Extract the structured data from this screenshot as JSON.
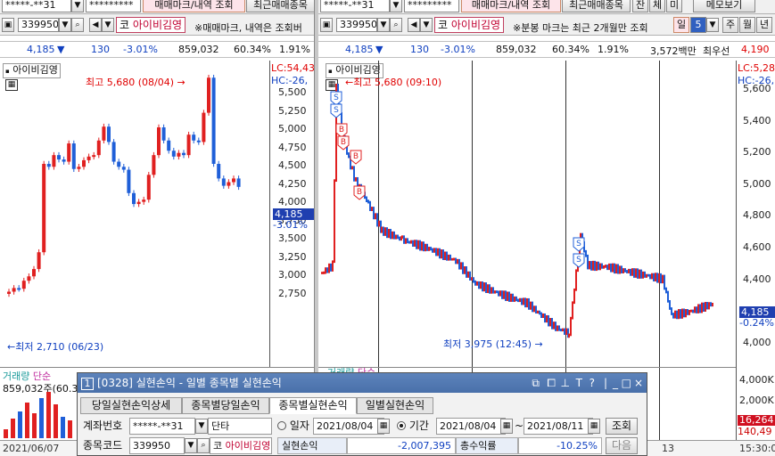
{
  "colors": {
    "up": "#e02020",
    "down": "#1f5fd8",
    "accent_pink": "#c00030",
    "title_bar": "#4970aa"
  },
  "left": {
    "account": "*****-**31",
    "password_mask": "*********",
    "trade_mark_button": "매매마크/내역 조회",
    "recent_trades_button": "최근매매종목",
    "code": "339950",
    "name_prefix": "코",
    "name": "아이비김영",
    "notice": "※매매마크, 내역은 조회버",
    "quote": {
      "price": "4,185",
      "arrow": "▼",
      "change": "130",
      "rate": "-3.01%",
      "volume": "859,032",
      "ratio": "60.34%",
      "turnover": "1.91%"
    },
    "chart_label": "아이비김영",
    "lc": "LC:54,43",
    "hc": "HC:-26,",
    "high_annotation": "최고 5,680 (08/04)",
    "low_annotation": "최저 2,710 (06/23)",
    "price_tag": "4,185",
    "price_tag_rate": "-3.01%",
    "volume_label": "거래량",
    "volume_label2": "단순",
    "volume_value": "859,032주(60.34",
    "date_label": "2021/06/07",
    "yticks": [
      "5,500",
      "5,250",
      "5,000",
      "4,750",
      "4,500",
      "4,250",
      "4,000",
      "3,750",
      "3,500",
      "3,250",
      "3,000",
      "2,750"
    ]
  },
  "right": {
    "account": "*****-**31",
    "password_mask": "*********",
    "trade_mark_button": "매매마크/내역 조회",
    "recent_trades_button": "최근매매종목",
    "btn_cham": "잔",
    "btn_je": "체",
    "btn_mi": "미",
    "memo_button": "메모보기",
    "code": "339950",
    "name_prefix": "코",
    "name": "아이비김영",
    "notice": "※분봉 마크는 최근 2개월만 조회",
    "period_il": "일",
    "period_num": "5",
    "period_ju": "주",
    "period_wol": "월",
    "period_nyeon": "년",
    "quote": {
      "price": "4,185",
      "arrow": "▼",
      "change": "130",
      "rate": "-3.01%",
      "volume": "859,032",
      "ratio": "60.34%",
      "turnover": "1.91%",
      "mktcap": "3,572백만",
      "best": "최우선",
      "best_price": "4,190"
    },
    "chart_label": "아이비김영",
    "lc": "LC:5,28",
    "hc": "HC:-26,",
    "high_annotation": "최고 5,680 (09:10)",
    "low_annotation": "최저 3,975 (12:45)",
    "price_tag": "4,185",
    "price_tag_rate": "-0.24%",
    "vol_axis_1": "4,000K",
    "vol_axis_2": "2,000K",
    "vol_tag_1": "16,264",
    "vol_tag_2": "140,49",
    "time_label": "15:30:0",
    "date_13": "13",
    "volume_label": "거래량",
    "volume_label2": "단순",
    "yticks": [
      "5,600",
      "5,400",
      "5,200",
      "5,000",
      "4,800",
      "4,600",
      "4,400",
      "4,200",
      "4,000"
    ]
  },
  "dialog": {
    "number": "1",
    "title": "[0328] 실현손익 - 일별 종목별 실현손익",
    "tabs": [
      "당일실현손익상세",
      "종목별당일손익",
      "종목별실현손익",
      "일별실현손익"
    ],
    "active_tab": 2,
    "account_label": "계좌번호",
    "account": "*****-**31",
    "account_type": "단타",
    "radio_date": "일자",
    "date_value": "2021/08/04",
    "radio_period": "기간",
    "period_from": "2021/08/04",
    "tilde": "~",
    "period_to": "2021/08/11",
    "query_button": "조회",
    "code_label": "종목코드",
    "code": "339950",
    "name_prefix": "코",
    "name": "아이비김영",
    "realized_label": "실현손익",
    "realized_value": "-2,007,395",
    "return_label": "총수익률",
    "return_value": "-10.25%",
    "next_button": "다음"
  }
}
